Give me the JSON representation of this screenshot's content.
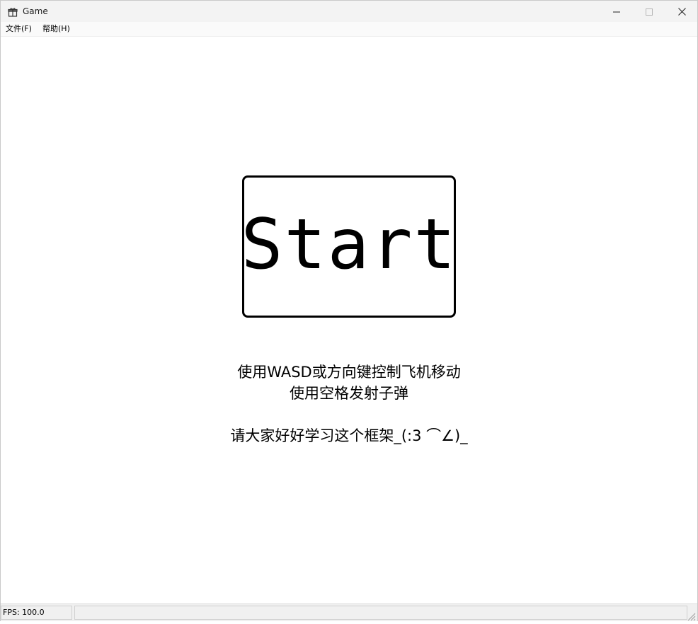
{
  "window": {
    "title": "Game",
    "icon": "gift-box-icon"
  },
  "menu": {
    "items": [
      {
        "label": "文件(F)"
      },
      {
        "label": "帮助(H)"
      }
    ]
  },
  "main": {
    "start_button_label": "Start",
    "instructions": [
      "使用WASD或方向键控制飞机移动",
      "使用空格发射子弹",
      "请大家好好学习这个框架_(:3 ⌒∠)_"
    ]
  },
  "statusbar": {
    "fps_text": "FPS: 100.0"
  }
}
